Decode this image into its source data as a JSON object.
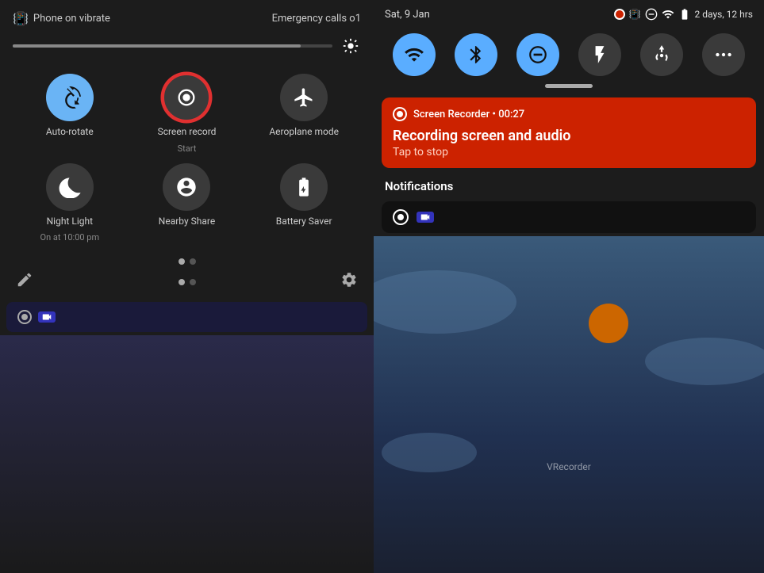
{
  "left": {
    "status": {
      "phone_vibrate": "Phone on vibrate",
      "emergency_calls": "Emergency calls o1"
    },
    "tiles": [
      {
        "id": "auto-rotate",
        "label": "Auto-rotate",
        "sublabel": "",
        "active": true,
        "icon": "↻"
      },
      {
        "id": "screen-record",
        "label": "Screen record",
        "sublabel": "Start",
        "active": false,
        "icon": "⊙",
        "highlighted": true
      },
      {
        "id": "aeroplane",
        "label": "Aeroplane mode",
        "sublabel": "",
        "active": false,
        "icon": "✈"
      },
      {
        "id": "night-light",
        "label": "Night Light",
        "sublabel": "On at 10:00 pm",
        "active": false,
        "icon": "☾"
      },
      {
        "id": "nearby-share",
        "label": "Nearby Share",
        "sublabel": "",
        "active": false,
        "icon": "⚡"
      },
      {
        "id": "battery-saver",
        "label": "Battery Saver",
        "sublabel": "",
        "active": false,
        "icon": "🔋"
      }
    ],
    "pagination": {
      "total": 2,
      "active": 0
    },
    "toolbar": {
      "edit": "✏",
      "settings": "⚙"
    }
  },
  "right": {
    "status": {
      "date": "Sat, 9 Jan",
      "battery_text": "2 days, 12 hrs"
    },
    "qs_buttons": [
      {
        "id": "wifi",
        "label": "wifi",
        "active": true
      },
      {
        "id": "bluetooth",
        "label": "bluetooth",
        "active": true
      },
      {
        "id": "dnd",
        "label": "dnd",
        "active": true
      },
      {
        "id": "flashlight",
        "label": "flashlight",
        "active": false
      },
      {
        "id": "hotspot",
        "label": "hotspot",
        "active": false
      },
      {
        "id": "more",
        "label": "more",
        "active": false
      }
    ],
    "screen_recorder": {
      "title": "Screen Recorder • 00:27",
      "body": "Recording screen and audio",
      "sub": "Tap to stop"
    },
    "notifications_label": "Notifications"
  }
}
